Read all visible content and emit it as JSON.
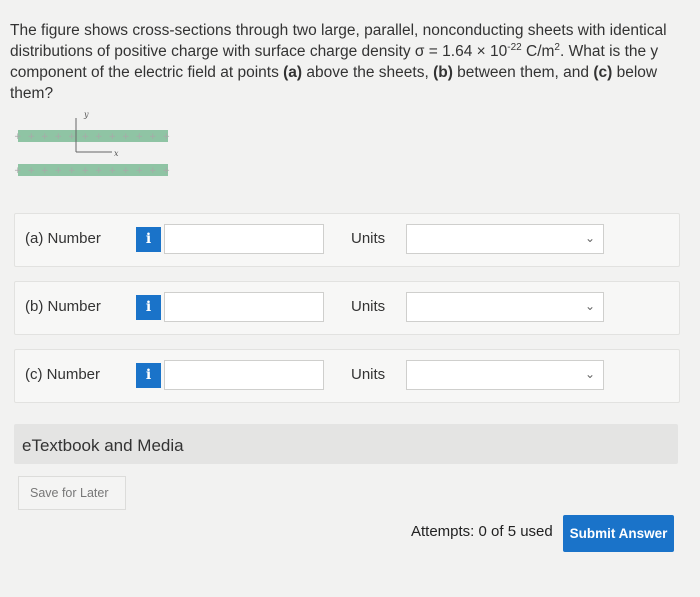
{
  "question": {
    "part1": "The figure shows cross-sections through two large, parallel, nonconducting sheets with identical distributions of positive charge with surface charge density σ = 1.64 × 10",
    "exponent": "-22",
    "unit": " C/m",
    "unit_exp": "2",
    "part2": ". What is the y component of the electric field at points ",
    "a_label": "(a)",
    "part3": " above the sheets, ",
    "b_label": "(b)",
    "part4": " between them, and ",
    "c_label": "(c)",
    "part5": " below them?"
  },
  "figure": {
    "axis_y": "y",
    "axis_x": "x",
    "plus_sign": "+",
    "sheet_color": "#8fc4a4"
  },
  "rows": [
    {
      "label": "(a)  Number",
      "info_icon": "i",
      "value": "",
      "units_label": "Units",
      "units_value": ""
    },
    {
      "label": "(b)  Number",
      "info_icon": "i",
      "value": "",
      "units_label": "Units",
      "units_value": ""
    },
    {
      "label": "(c)  Number",
      "info_icon": "i",
      "value": "",
      "units_label": "Units",
      "units_value": ""
    }
  ],
  "etextbook": "eTextbook and Media",
  "save_label": "Save for Later",
  "attempts": "Attempts: 0 of 5 used",
  "submit_label": "Submit Answer",
  "colors": {
    "accent": "#1a73c9"
  }
}
